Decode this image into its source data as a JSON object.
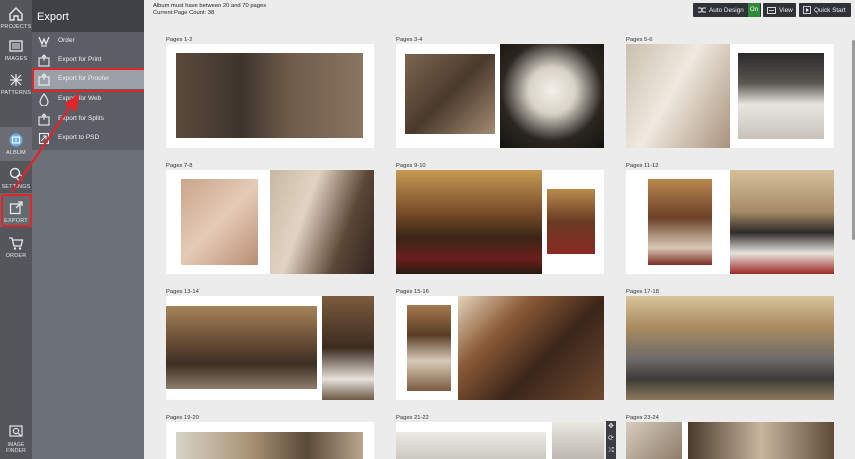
{
  "rail": {
    "items": [
      {
        "label": "PROJECTS",
        "icon": "home-icon"
      },
      {
        "label": "IMAGES",
        "icon": "images-icon"
      },
      {
        "label": "PATTERNS",
        "icon": "patterns-icon"
      },
      {
        "label": "ALBUM",
        "icon": "album-icon"
      },
      {
        "label": "SETTINGS",
        "icon": "settings-icon"
      },
      {
        "label": "EXPORT",
        "icon": "export-icon"
      },
      {
        "label": "ORDER",
        "icon": "cart-icon"
      },
      {
        "label": "IMAGE FINDER",
        "icon": "image-finder-icon"
      }
    ]
  },
  "panel": {
    "title": "Export",
    "items": [
      {
        "label": "Order",
        "icon": "order-icon"
      },
      {
        "label": "Export for Print",
        "icon": "print-icon"
      },
      {
        "label": "Export for Proofer",
        "icon": "proofer-icon"
      },
      {
        "label": "Export for Web",
        "icon": "web-icon"
      },
      {
        "label": "Export for Splits",
        "icon": "splits-icon"
      },
      {
        "label": "Export to PSD",
        "icon": "psd-icon"
      }
    ]
  },
  "main": {
    "info_line1": "Album must have between 20 and 70 pages",
    "info_line2": "Current Page Count: 38"
  },
  "toolbar": {
    "auto_design_label": "Auto Design",
    "auto_design_state": "On",
    "view_label": "View",
    "quick_start_label": "Quick Start"
  },
  "spreads": [
    {
      "label": "Pages 1-2"
    },
    {
      "label": "Pages 3-4"
    },
    {
      "label": "Pages 5-6"
    },
    {
      "label": "Pages 7-8"
    },
    {
      "label": "Pages 9-10"
    },
    {
      "label": "Pages 11-12"
    },
    {
      "label": "Pages 13-14"
    },
    {
      "label": "Pages 15-16"
    },
    {
      "label": "Pages 17-18"
    },
    {
      "label": "Pages 19-20"
    },
    {
      "label": "Pages 21-22"
    },
    {
      "label": "Pages 23-24"
    }
  ],
  "colors": {
    "annotation_red": "#e3232b",
    "on_green": "#2e8a38"
  }
}
